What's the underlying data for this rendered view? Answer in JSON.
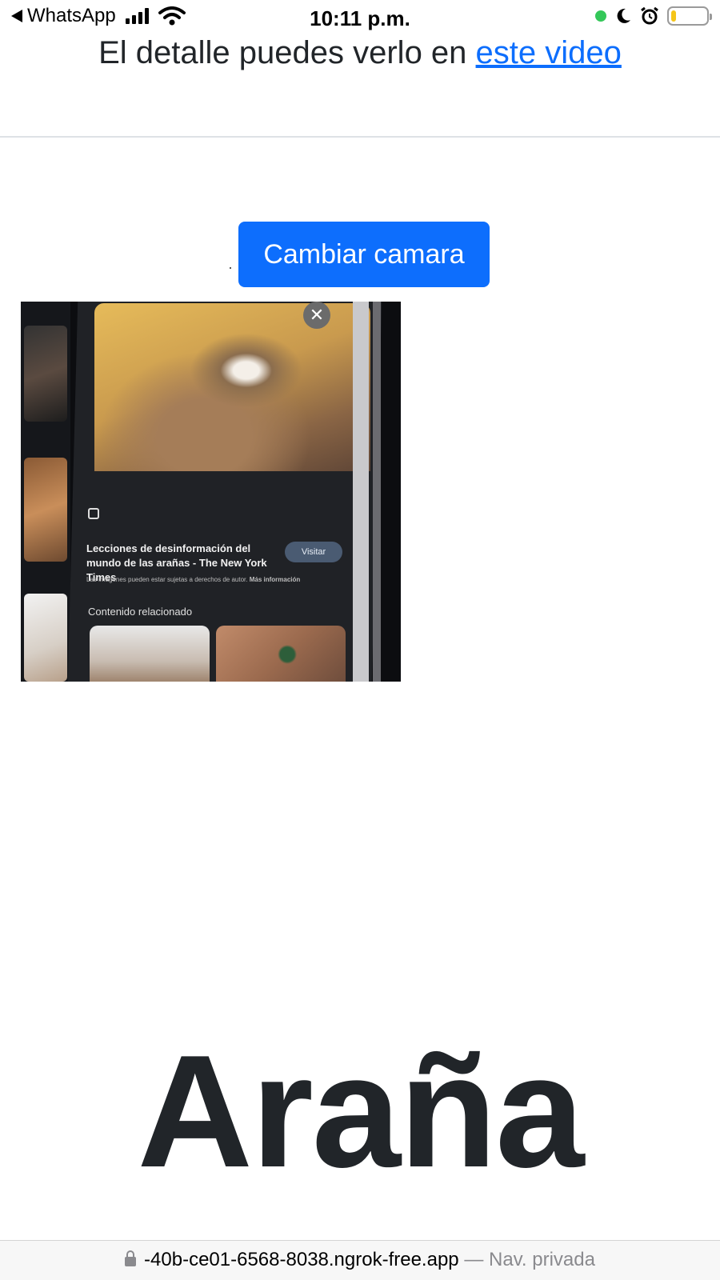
{
  "status_bar": {
    "back_app": "WhatsApp",
    "time": "10:11 p.m.",
    "battery_level": 0.15,
    "colors": {
      "camera_dot": "#34c759",
      "battery_fill": "#f5c518"
    }
  },
  "header": {
    "text": "El detalle puedes verlo en",
    "link_label": "este video"
  },
  "camera": {
    "switch_button": "Cambiar camara",
    "preview": {
      "caption_title": "Lecciones de desinformación del mundo de las arañas - The New York Times",
      "visit_label": "Visitar",
      "disclaimer": "Las imágenes pueden estar sujetas a derechos de autor.",
      "more_info": "Más información",
      "related_label": "Contenido relacionado"
    }
  },
  "result": {
    "label": "Araña"
  },
  "url_bar": {
    "url": "-40b-ce01-6568-8038.ngrok-free.app",
    "private_label": " — Nav. privada"
  },
  "theme": {
    "primary": "#0d6efd",
    "text": "#212529"
  }
}
